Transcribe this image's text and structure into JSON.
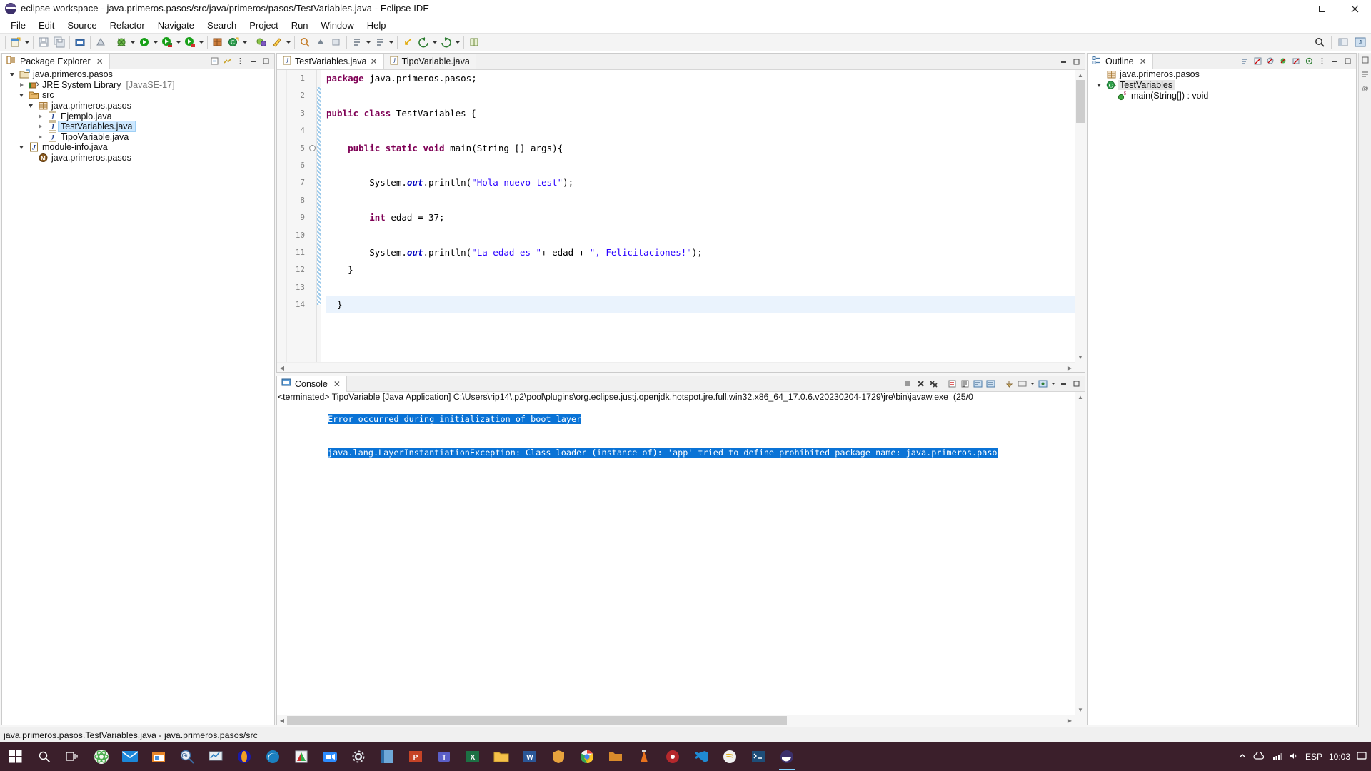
{
  "window": {
    "title": "eclipse-workspace - java.primeros.pasos/src/java/primeros/pasos/TestVariables.java - Eclipse IDE",
    "app_icon": "eclipse-icon",
    "minimize": "minimize-icon",
    "maximize": "maximize-icon",
    "close": "close-icon"
  },
  "menu": {
    "items": [
      "File",
      "Edit",
      "Source",
      "Refactor",
      "Navigate",
      "Search",
      "Project",
      "Run",
      "Window",
      "Help"
    ]
  },
  "toolbar": {
    "groups": [
      [
        "new-wizard",
        "new-dropdown"
      ],
      [
        "save",
        "save-all"
      ],
      [
        "print"
      ],
      [
        "new-java-package"
      ],
      [
        "external-tools",
        "external-tools-dropdown"
      ],
      [
        "debug",
        "debug-dropdown"
      ],
      [
        "run",
        "run-dropdown"
      ],
      [
        "coverage",
        "coverage-dropdown"
      ],
      [
        "new-java-project",
        "new-java-class"
      ],
      [
        "open-type",
        "open-task"
      ],
      [
        "search",
        "search-dropdown"
      ],
      [
        "annotation",
        "annotation-dropdown"
      ],
      [
        "last-edit",
        "back",
        "forward"
      ],
      [
        "pin-editor"
      ]
    ],
    "right": [
      "quick-access-search",
      "open-perspective",
      "java-perspective"
    ]
  },
  "package_explorer": {
    "tab_label": "Package Explorer",
    "tab_icon": "package-explorer-icon",
    "close_icon": "close-icon",
    "view_buttons": [
      "collapse-all-icon",
      "link-with-editor-icon",
      "view-menu-icon",
      "minimize-icon",
      "maximize-icon"
    ],
    "tree": [
      {
        "label": "java.primeros.pasos",
        "icon": "java-project-icon",
        "indent": 0,
        "twist": "down",
        "selected": false,
        "suffix": ""
      },
      {
        "label": "JRE System Library",
        "icon": "library-icon",
        "indent": 1,
        "twist": "right",
        "selected": false,
        "suffix": "[JavaSE-17]"
      },
      {
        "label": "src",
        "icon": "source-folder-icon",
        "indent": 1,
        "twist": "down",
        "selected": false,
        "suffix": ""
      },
      {
        "label": "java.primeros.pasos",
        "icon": "package-icon",
        "indent": 2,
        "twist": "down",
        "selected": false,
        "suffix": ""
      },
      {
        "label": "Ejemplo.java",
        "icon": "java-file-icon",
        "indent": 3,
        "twist": "right",
        "selected": false,
        "suffix": ""
      },
      {
        "label": "TestVariables.java",
        "icon": "java-file-icon",
        "indent": 3,
        "twist": "right",
        "selected": true,
        "suffix": ""
      },
      {
        "label": "TipoVariable.java",
        "icon": "java-file-icon",
        "indent": 3,
        "twist": "right",
        "selected": false,
        "suffix": ""
      },
      {
        "label": "module-info.java",
        "icon": "java-file-icon",
        "indent": 1,
        "twist": "down",
        "selected": false,
        "suffix": ""
      },
      {
        "label": "java.primeros.pasos",
        "icon": "module-icon",
        "indent": 2,
        "twist": "none",
        "selected": false,
        "suffix": ""
      }
    ]
  },
  "editor": {
    "tabs": [
      {
        "label": "TestVariables.java",
        "icon": "java-file-icon",
        "active": true,
        "close_icon": "close-icon"
      },
      {
        "label": "TipoVariable.java",
        "icon": "java-file-icon",
        "active": false,
        "close_icon": ""
      }
    ],
    "minimize_icon": "minimize-icon",
    "maximize_icon": "maximize-icon",
    "line_numbers": [
      "1",
      "2",
      "3",
      "4",
      "5",
      "6",
      "7",
      "8",
      "9",
      "10",
      "11",
      "12",
      "13",
      "14"
    ],
    "highlight_line": 14,
    "fold_marker_line": 5,
    "lines": [
      {
        "n": 1,
        "tokens": [
          {
            "t": "package",
            "c": "kw"
          },
          {
            "t": " java.primeros.pasos;",
            "c": ""
          }
        ]
      },
      {
        "n": 2,
        "tokens": []
      },
      {
        "n": 3,
        "tokens": [
          {
            "t": "public class",
            "c": "kw"
          },
          {
            "t": " TestVariables ",
            "c": ""
          },
          {
            "t": "{",
            "c": "cursor-brace"
          }
        ]
      },
      {
        "n": 4,
        "tokens": []
      },
      {
        "n": 5,
        "tokens": [
          {
            "t": "    ",
            "c": ""
          },
          {
            "t": "public static void",
            "c": "kw"
          },
          {
            "t": " main(String [] args){",
            "c": ""
          }
        ]
      },
      {
        "n": 6,
        "tokens": []
      },
      {
        "n": 7,
        "tokens": [
          {
            "t": "        System.",
            "c": ""
          },
          {
            "t": "out",
            "c": "fld"
          },
          {
            "t": ".println(",
            "c": ""
          },
          {
            "t": "\"Hola nuevo test\"",
            "c": "str"
          },
          {
            "t": ");",
            "c": ""
          }
        ]
      },
      {
        "n": 8,
        "tokens": []
      },
      {
        "n": 9,
        "tokens": [
          {
            "t": "        ",
            "c": ""
          },
          {
            "t": "int",
            "c": "kw"
          },
          {
            "t": " edad = 37;",
            "c": ""
          }
        ]
      },
      {
        "n": 10,
        "tokens": []
      },
      {
        "n": 11,
        "tokens": [
          {
            "t": "        System.",
            "c": ""
          },
          {
            "t": "out",
            "c": "fld"
          },
          {
            "t": ".println(",
            "c": ""
          },
          {
            "t": "\"La edad es \"",
            "c": "str"
          },
          {
            "t": "+ edad + ",
            "c": ""
          },
          {
            "t": "\", Felicitaciones!\"",
            "c": "str"
          },
          {
            "t": ");",
            "c": ""
          }
        ]
      },
      {
        "n": 12,
        "tokens": [
          {
            "t": "    }",
            "c": ""
          }
        ]
      },
      {
        "n": 13,
        "tokens": []
      },
      {
        "n": 14,
        "tokens": [
          {
            "t": "  }",
            "c": ""
          }
        ]
      }
    ]
  },
  "outline": {
    "tab_label": "Outline",
    "tab_icon": "outline-icon",
    "close_icon": "close-icon",
    "view_buttons": [
      "sort-icon",
      "hide-fields-icon",
      "hide-static-icon",
      "hide-nonpublic-icon",
      "hide-local-types-icon",
      "focus-icon",
      "view-menu-icon",
      "minimize-icon",
      "maximize-icon"
    ],
    "tree": [
      {
        "label": "java.primeros.pasos",
        "icon": "package-icon",
        "indent": 0,
        "twist": "none",
        "selected": false
      },
      {
        "label": "TestVariables",
        "icon": "class-icon",
        "indent": 0,
        "twist": "down",
        "selected": true
      },
      {
        "label": "main(String[]) : void",
        "icon": "method-public-static-icon",
        "indent": 1,
        "twist": "none",
        "selected": false
      }
    ]
  },
  "console": {
    "tab_label": "Console",
    "tab_icon": "console-icon",
    "close_icon": "close-icon",
    "view_buttons": [
      "terminate-icon",
      "remove-launch-icon",
      "remove-all-launches-icon",
      "clear-console-icon",
      "scroll-lock-icon",
      "word-wrap-icon",
      "show-console-icon",
      "pin-console-icon",
      "display-console-icon",
      "open-console-icon",
      "minimize-icon",
      "maximize-icon"
    ],
    "header": "<terminated> TipoVariable [Java Application] C:\\Users\\rip14\\.p2\\pool\\plugins\\org.eclipse.justj.openjdk.hotspot.jre.full.win32.x86_64_17.0.6.v20230204-1729\\jre\\bin\\javaw.exe  (25/0",
    "error_lines": [
      "Error occurred during initialization of boot layer",
      "java.lang.LayerInstantiationException: Class loader (instance of): 'app' tried to define prohibited package name: java.primeros.paso"
    ],
    "selection_color": "#0a73d6"
  },
  "status_bar": {
    "text": "java.primeros.pasos.TestVariables.java - java.primeros.pasos/src"
  },
  "taskbar": {
    "items": [
      "windows-start-icon",
      "search-icon",
      "task-view-icon",
      "react-icon",
      "mail-icon",
      "store-icon",
      "gu-search-icon",
      "monitor-chart-icon",
      "opera-icon",
      "edge-icon",
      "pdf-icon",
      "zoom-icon",
      "settings-icon",
      "book-icon",
      "powerpoint-icon",
      "teams-icon",
      "excel-icon",
      "explorer-icon",
      "word-icon",
      "shield-icon",
      "chrome-icon",
      "folder-icon",
      "vlc-icon",
      "music-icon",
      "vscode-icon",
      "spotify-icon",
      "terminal-icon",
      "eclipse-icon"
    ],
    "tray": {
      "chevron": "show-hidden-icons",
      "icons": [
        "onedrive-icon",
        "network-icon",
        "volume-icon"
      ],
      "language": "ESP",
      "time": "10:03",
      "notifications": "notifications-icon"
    }
  }
}
